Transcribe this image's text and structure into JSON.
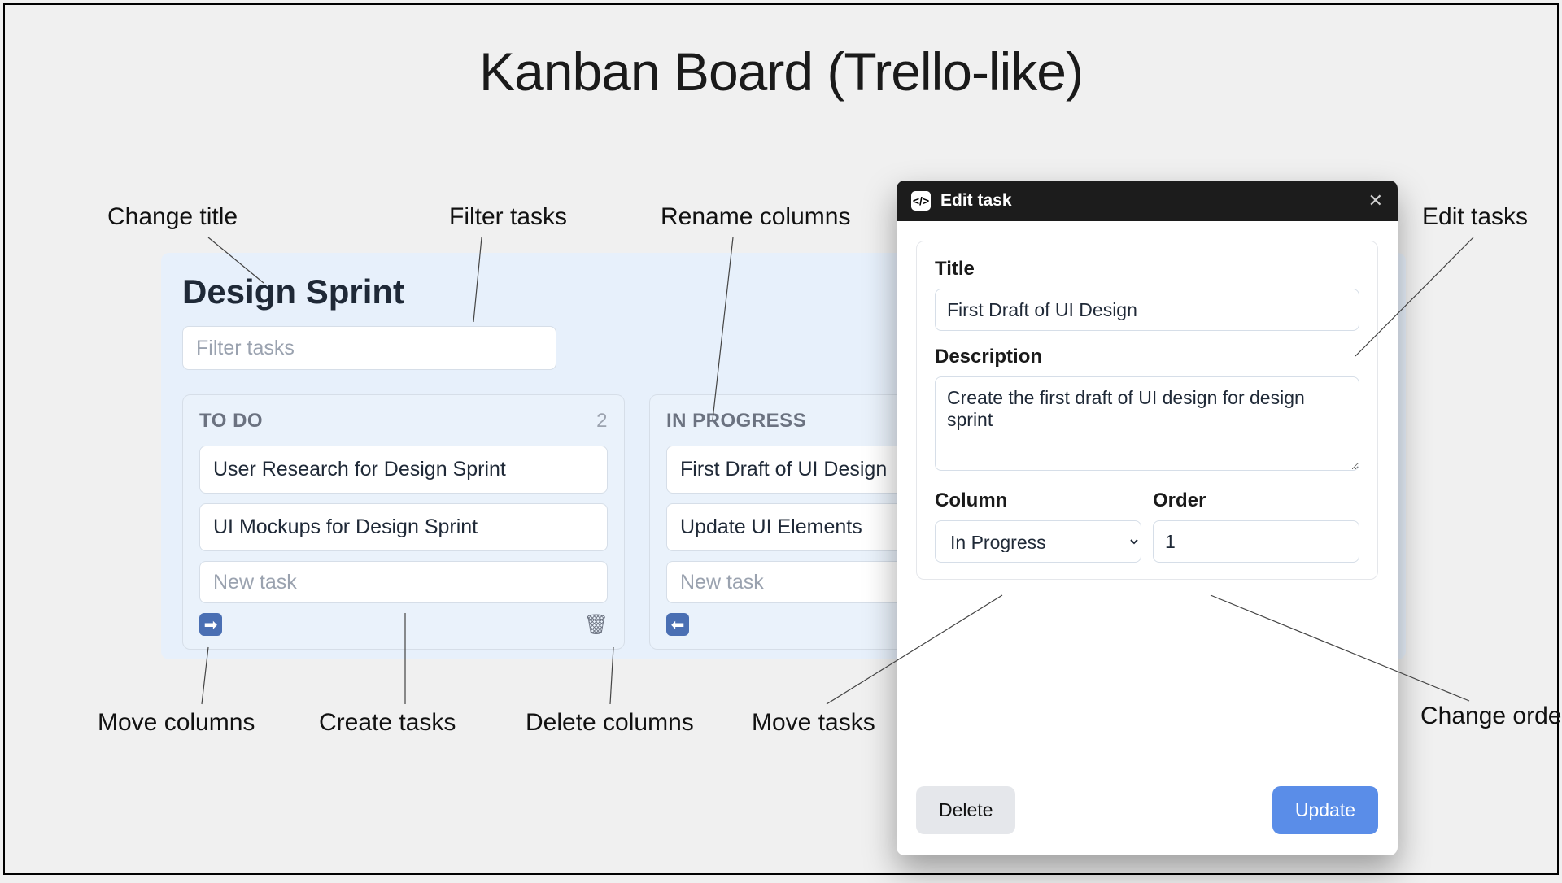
{
  "page_title": "Kanban Board (Trello-like)",
  "board": {
    "title": "Design Sprint",
    "filter_placeholder": "Filter tasks"
  },
  "columns": [
    {
      "name": "TO DO",
      "count": "2",
      "tasks": [
        "User Research for Design Sprint",
        "UI Mockups for Design Sprint"
      ],
      "newtask_placeholder": "New task"
    },
    {
      "name": "IN PROGRESS",
      "count": "",
      "tasks": [
        "First Draft of UI Design",
        "Update UI Elements"
      ],
      "newtask_placeholder": "New task"
    }
  ],
  "modal": {
    "header": "Edit task",
    "labels": {
      "title": "Title",
      "description": "Description",
      "column": "Column",
      "order": "Order"
    },
    "fields": {
      "title": "First Draft of UI Design",
      "description": "Create the first draft of UI design for design sprint",
      "column_selected": "In Progress",
      "order": "1"
    },
    "buttons": {
      "delete": "Delete",
      "update": "Update"
    }
  },
  "annotations": {
    "change_title": "Change title",
    "filter_tasks": "Filter tasks",
    "rename_columns": "Rename columns",
    "edit_tasks": "Edit tasks",
    "move_columns": "Move columns",
    "create_tasks": "Create tasks",
    "delete_columns": "Delete columns",
    "move_tasks": "Move tasks",
    "change_order": "Change order"
  },
  "icons": {
    "code": "</>",
    "close": "✕",
    "arrow_right": "➡",
    "arrow_left": "⬅",
    "trash": "🗑"
  }
}
